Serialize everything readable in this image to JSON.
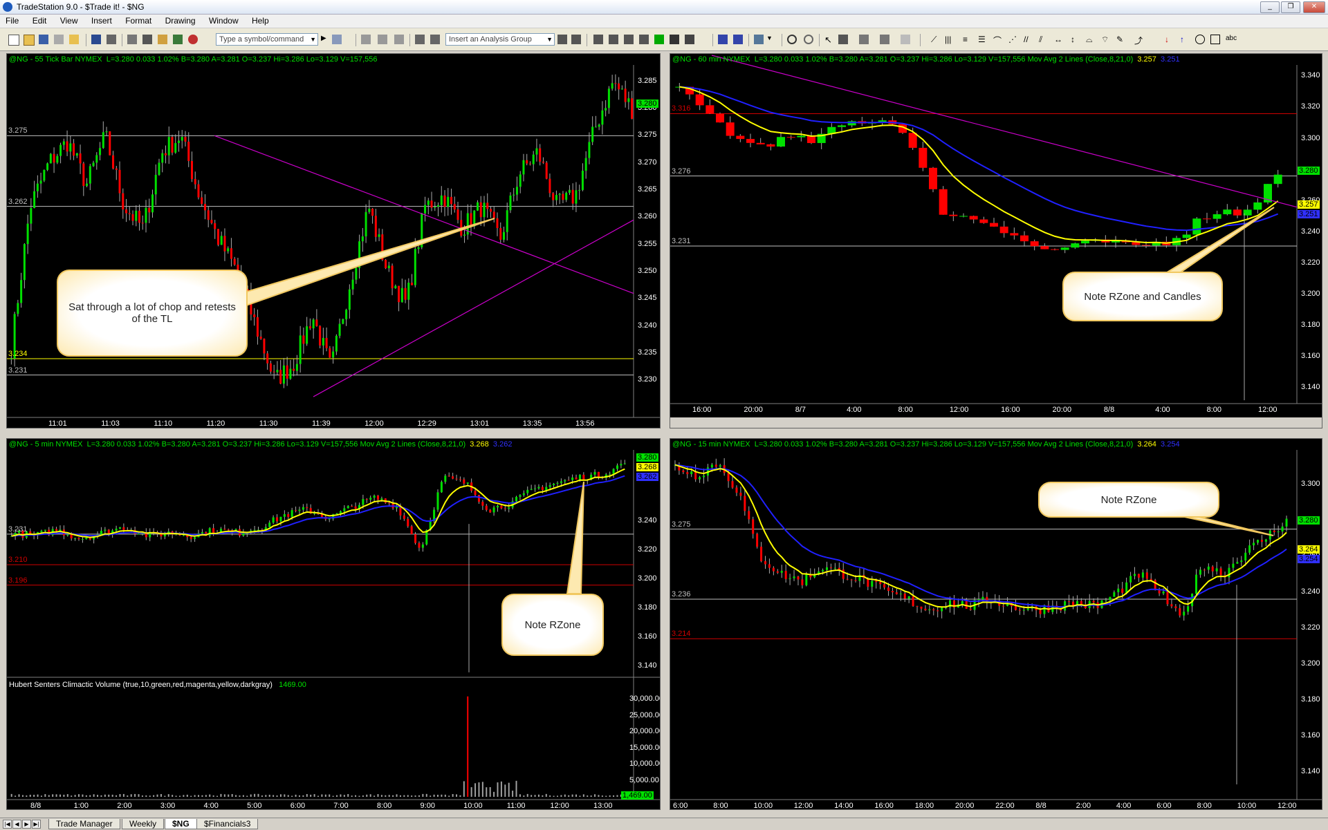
{
  "window": {
    "title": "TradeStation 9.0 - $Trade it! - $NG",
    "min": "_",
    "restore": "❐",
    "close": "✕"
  },
  "menu": [
    "File",
    "Edit",
    "View",
    "Insert",
    "Format",
    "Drawing",
    "Window",
    "Help"
  ],
  "toolbar": {
    "symbol_placeholder": "Type a symbol/command",
    "analysis_placeholder": "Insert an Analysis Group",
    "abc": "abc"
  },
  "charts": {
    "tick": {
      "header": {
        "symbol": "@NG - 55 Tick Bar  NYMEX",
        "quote": "L=3.280  0.033   1.02%   B=3.280  A=3.281  O=3.237  Hi=3.286  Lo=3.129  V=157,556"
      },
      "y_ticks": [
        "3.285",
        "3.280",
        "3.275",
        "3.270",
        "3.265",
        "3.260",
        "3.255",
        "3.250",
        "3.245",
        "3.240",
        "3.235",
        "3.230"
      ],
      "last_price": "3.280",
      "levels": [
        {
          "label": "3.275",
          "value": 3.275,
          "color": "#c0c0c0"
        },
        {
          "label": "3.262",
          "value": 3.262,
          "color": "#c0c0c0"
        },
        {
          "label": "3.234",
          "value": 3.234,
          "color": "#ffff00"
        },
        {
          "label": "3.231",
          "value": 3.231,
          "color": "#c0c0c0"
        }
      ],
      "x_ticks": [
        "11:01",
        "11:03",
        "11:10",
        "11:20",
        "11:30",
        "11:39",
        "12:00",
        "12:29",
        "13:01",
        "13:35",
        "13:56"
      ],
      "callout": "Sat through a lot of chop and retests of the TL"
    },
    "h60": {
      "header": {
        "symbol": "@NG - 60 min  NYMEX",
        "quote": "L=3.280  0.033   1.02%   B=3.280  A=3.281  O=3.237  Hi=3.286  Lo=3.129  V=157,556  Mov Avg 2 Lines (Close,8,21,0)",
        "ma_fast": "3.257",
        "ma_slow": "3.251"
      },
      "y_ticks": [
        "3.340",
        "3.320",
        "3.300",
        "3.260",
        "3.240",
        "3.220",
        "3.200",
        "3.180",
        "3.160",
        "3.140"
      ],
      "price_boxes": [
        {
          "label": "3.280",
          "color": "#00e000"
        },
        {
          "label": "3.257",
          "color": "#ffff00"
        },
        {
          "label": "3.251",
          "color": "#3030ff"
        }
      ],
      "levels": [
        {
          "label": "3.276",
          "value": 3.276,
          "color": "#c0c0c0"
        },
        {
          "label": "3.231",
          "value": 3.231,
          "color": "#c0c0c0"
        },
        {
          "label": "3.316",
          "value": 3.316,
          "color": "#d00000"
        }
      ],
      "x_ticks": [
        "16:00",
        "20:00",
        "8/7",
        "4:00",
        "8:00",
        "12:00",
        "16:00",
        "20:00",
        "8/8",
        "4:00",
        "8:00",
        "12:00"
      ],
      "callout": "Note RZone and Candles"
    },
    "m5": {
      "header": {
        "symbol": "@NG - 5 min  NYMEX",
        "quote": "L=3.280  0.033   1.02%   B=3.280  A=3.281  O=3.237  Hi=3.286  Lo=3.129  V=157,556  Mov Avg 2 Lines (Close,8,21,0)",
        "ma_fast": "3.268",
        "ma_slow": "3.262"
      },
      "y_ticks": [
        "3.240",
        "3.220",
        "3.200",
        "3.180",
        "3.160",
        "3.140"
      ],
      "price_boxes": [
        {
          "label": "3.280",
          "color": "#00e000"
        },
        {
          "label": "3.268",
          "color": "#ffff00"
        },
        {
          "label": "3.262",
          "color": "#3030ff"
        }
      ],
      "levels": [
        {
          "label": "3.231",
          "value": 3.231,
          "color": "#c0c0c0"
        },
        {
          "label": "3.210",
          "value": 3.21,
          "color": "#d00000"
        },
        {
          "label": "3.196",
          "value": 3.196,
          "color": "#d00000"
        }
      ],
      "volume_header": "Hubert Senters Climactic Volume (true,10,green,red,magenta,yellow,darkgray)",
      "volume_value": "1469.00",
      "vol_ticks": [
        "30,000.00",
        "25,000.00",
        "20,000.00",
        "15,000.00",
        "10,000.00",
        "5,000.00"
      ],
      "vol_box": "1,469.00",
      "x_ticks": [
        "8/8",
        "1:00",
        "2:00",
        "3:00",
        "4:00",
        "5:00",
        "6:00",
        "7:00",
        "8:00",
        "9:00",
        "10:00",
        "11:00",
        "12:00",
        "13:00"
      ],
      "callout": "Note RZone"
    },
    "m15": {
      "header": {
        "symbol": "@NG - 15 min  NYMEX",
        "quote": "L=3.280  0.033   1.02%   B=3.280  A=3.281  O=3.237  Hi=3.286  Lo=3.129  V=157,556  Mov Avg 2 Lines (Close,8,21,0)",
        "ma_fast": "3.264",
        "ma_slow": "3.254"
      },
      "y_ticks": [
        "3.300",
        "3.280",
        "3.260",
        "3.240",
        "3.220",
        "3.200",
        "3.180",
        "3.160",
        "3.140"
      ],
      "price_boxes": [
        {
          "label": "3.280",
          "color": "#00e000"
        },
        {
          "label": "3.264",
          "color": "#ffff00"
        },
        {
          "label": "3.254",
          "color": "#3030ff"
        }
      ],
      "levels": [
        {
          "label": "3.275",
          "value": 3.275,
          "color": "#c0c0c0"
        },
        {
          "label": "3.236",
          "value": 3.236,
          "color": "#c0c0c0"
        },
        {
          "label": "3.214",
          "value": 3.214,
          "color": "#d00000"
        }
      ],
      "x_ticks": [
        "6:00",
        "8:00",
        "10:00",
        "12:00",
        "14:00",
        "16:00",
        "18:00",
        "20:00",
        "22:00",
        "8/8",
        "2:00",
        "4:00",
        "6:00",
        "8:00",
        "10:00",
        "12:00"
      ],
      "callout": "Note RZone"
    }
  },
  "tabs": [
    "Trade Manager",
    "Weekly",
    "$NG",
    "$Financials3"
  ],
  "active_tab": "$NG",
  "colors": {
    "up": "#00e000",
    "down": "#ff0000",
    "ma_fast": "#ffff00",
    "ma_slow": "#2020ff",
    "trendline": "#cc00cc",
    "callout_border": "#f1c860"
  }
}
